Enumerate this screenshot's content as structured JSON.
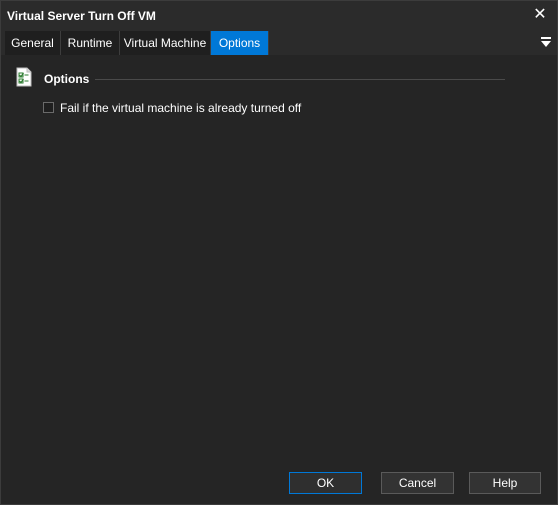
{
  "window": {
    "title": "Virtual Server Turn Off VM"
  },
  "tabs": [
    "General",
    "Runtime",
    "Virtual Machine",
    "Options"
  ],
  "active_tab": "Options",
  "options_group": {
    "title": "Options",
    "checkbox": {
      "label": "Fail if the virtual machine is already turned off",
      "checked": false
    }
  },
  "buttons": {
    "ok": "OK",
    "cancel": "Cancel",
    "help": "Help"
  },
  "colors": {
    "accent": "#0078d7",
    "background": "#252525",
    "text": "#ffffff"
  },
  "icons": {
    "close": "close-icon",
    "menu": "dropdown-arrow-icon",
    "group": "checklist-icon"
  }
}
